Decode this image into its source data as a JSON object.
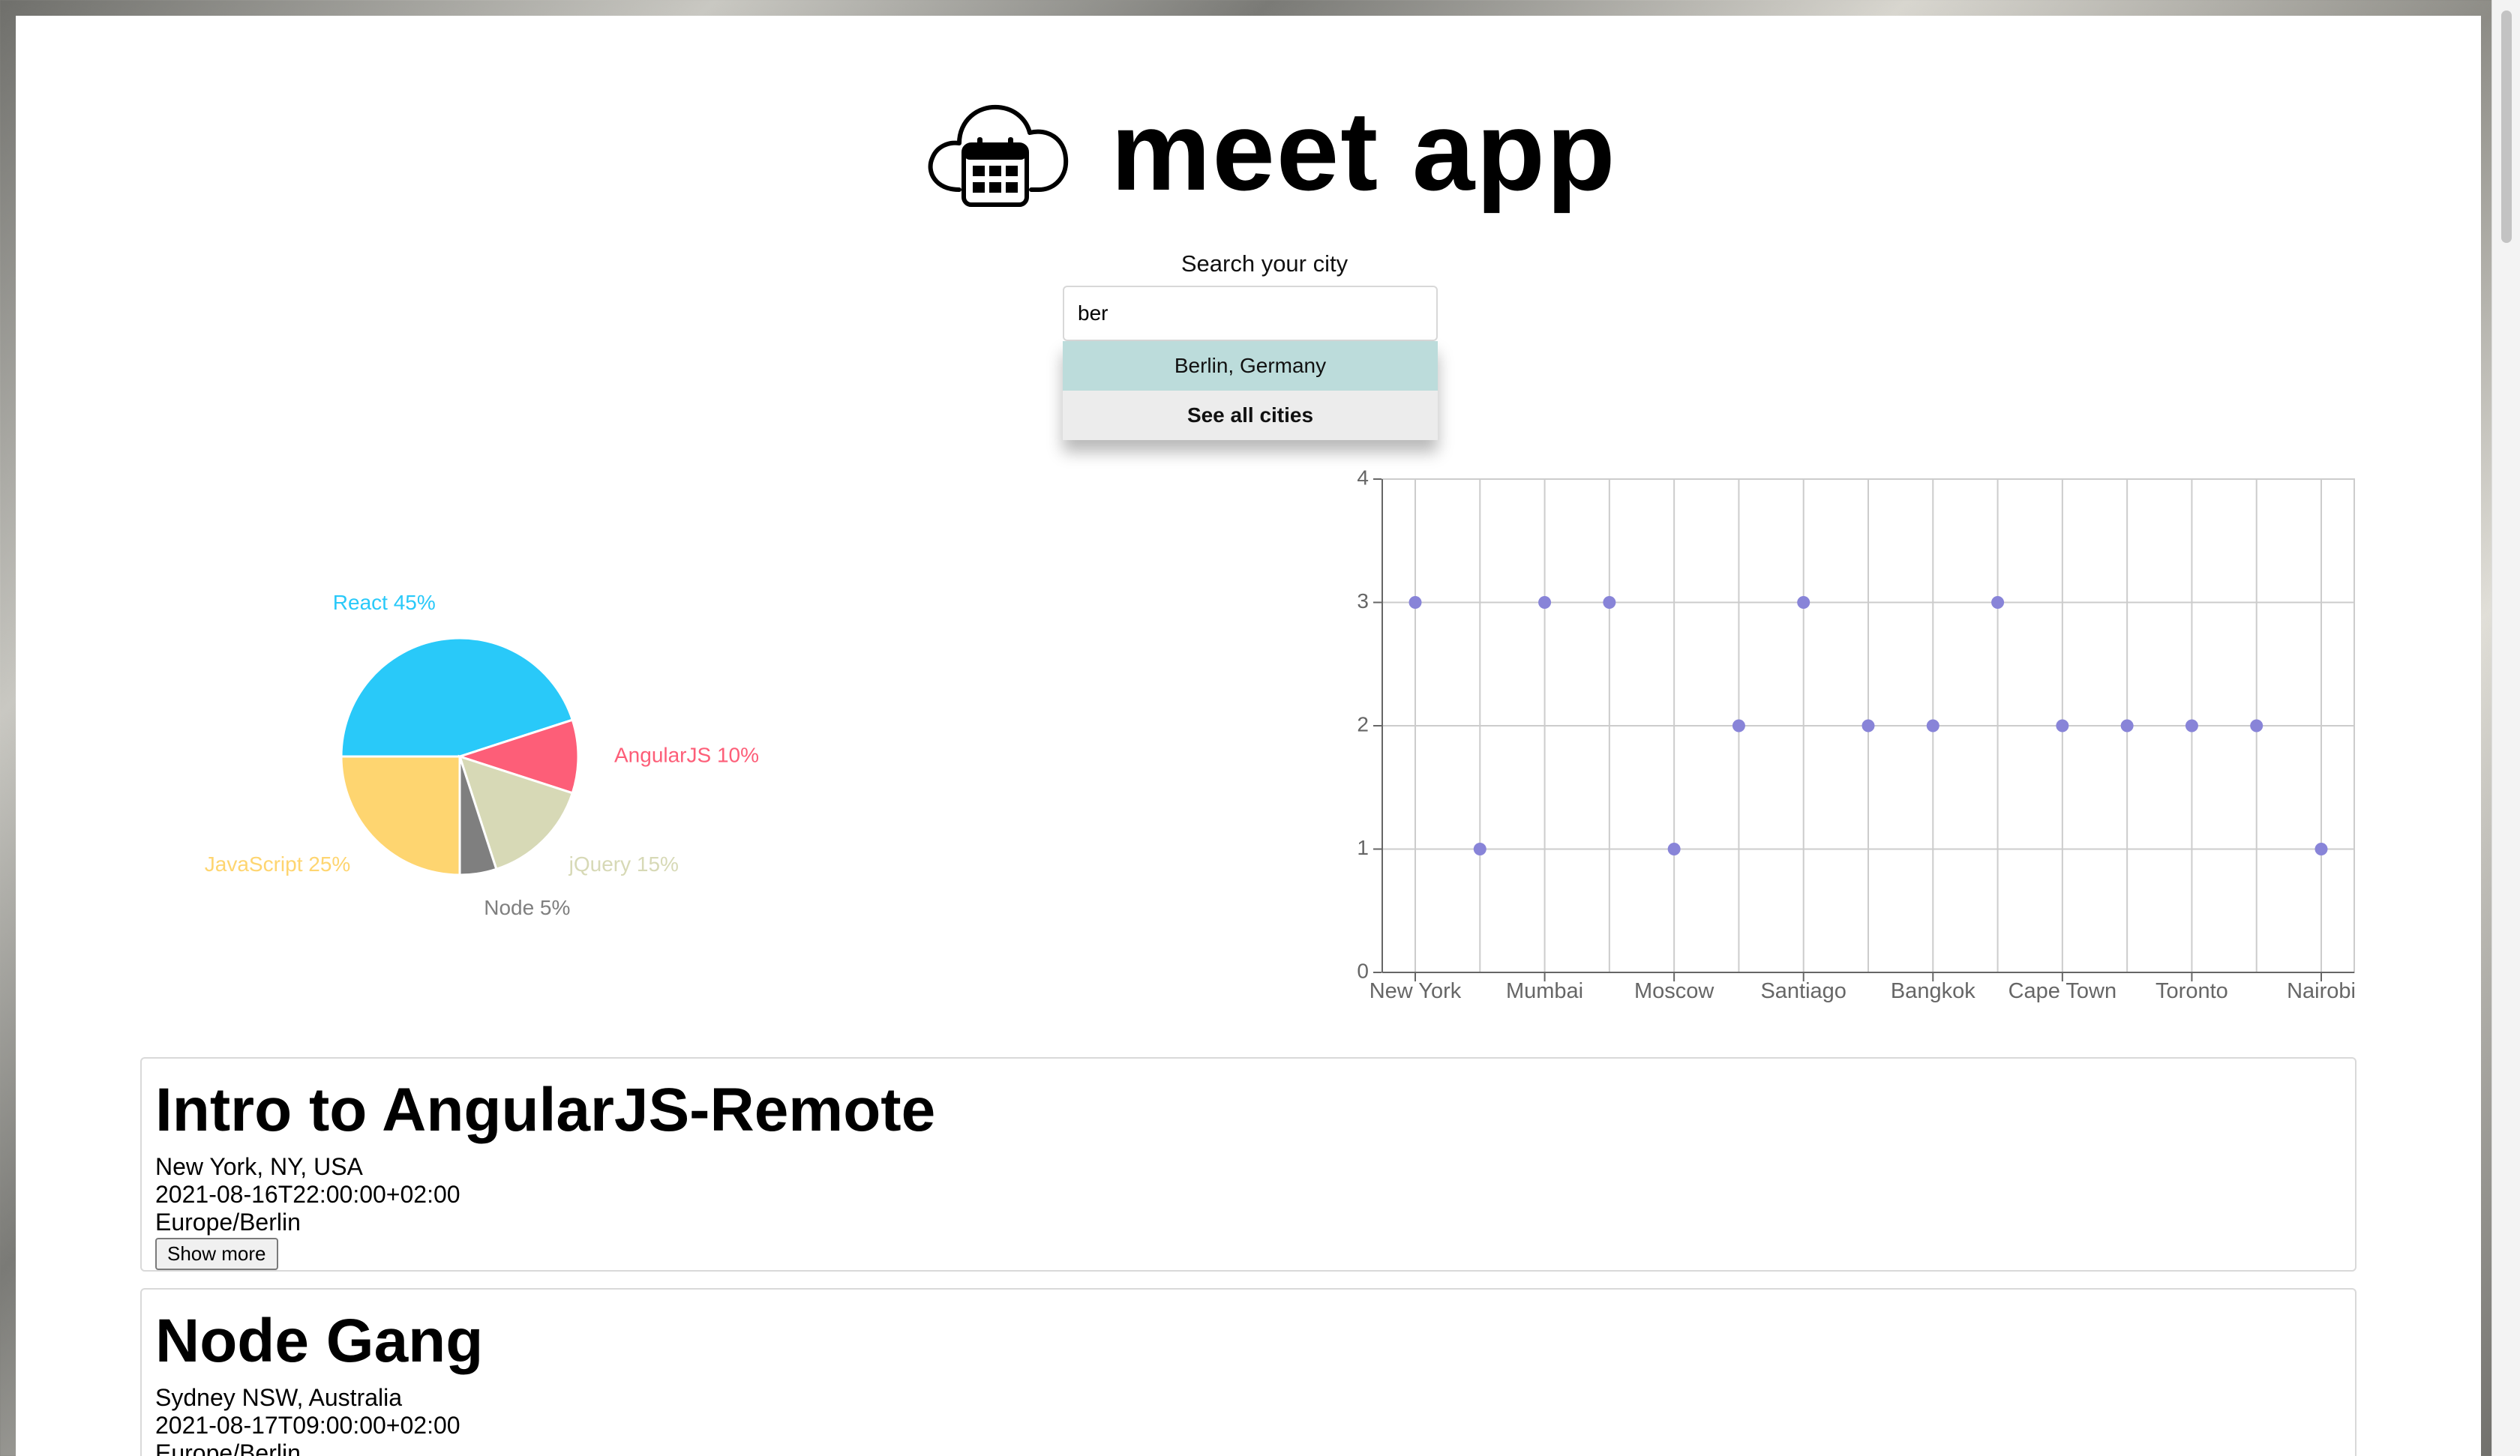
{
  "app": {
    "title": "meet app",
    "logo_icon": "cloud-calendar-icon"
  },
  "search": {
    "label": "Search your city",
    "value": "ber",
    "suggestions": [
      "Berlin, Germany"
    ],
    "see_all_label": "See all cities"
  },
  "colors": {
    "react": "#29c9f9",
    "javascript": "#fed570",
    "angularjs": "#fd5e78",
    "jquery": "#d7d9b6",
    "node": "#7f7f7f",
    "scatter_point": "#8884d8"
  },
  "chart_data": [
    {
      "type": "pie",
      "slices": [
        {
          "name": "React",
          "value": 45,
          "label": "React 45%",
          "color": "#29c9f9"
        },
        {
          "name": "AngularJS",
          "value": 10,
          "label": "AngularJS 10%",
          "color": "#fd5e78"
        },
        {
          "name": "jQuery",
          "value": 15,
          "label": "jQuery 15%",
          "color": "#d7d9b6"
        },
        {
          "name": "Node",
          "value": 5,
          "label": "Node 5%",
          "color": "#7f7f7f"
        },
        {
          "name": "JavaScript",
          "value": 25,
          "label": "JavaScript 25%",
          "color": "#fed570"
        }
      ]
    },
    {
      "type": "scatter",
      "x": [
        "New York",
        "",
        "Mumbai",
        "",
        "Moscow",
        "",
        "Santiago",
        "",
        "Bangkok",
        "",
        "Cape Town",
        "",
        "Toronto",
        "",
        "Nairobi"
      ],
      "xticks": [
        "New York",
        "Mumbai",
        "Moscow",
        "Santiago",
        "Bangkok",
        "Cape Town",
        "Toronto",
        "Nairobi"
      ],
      "y": [
        3,
        1,
        3,
        3,
        1,
        2,
        3,
        2,
        2,
        3,
        2,
        2,
        2,
        2,
        1
      ],
      "yticks": [
        "0",
        "1",
        "2",
        "3",
        "4"
      ],
      "ylim": [
        0,
        4
      ],
      "grid": true
    }
  ],
  "events": [
    {
      "title": "Intro to AngularJS-Remote",
      "location": "New York, NY, USA",
      "start": "2021-08-16T22:00:00+02:00",
      "timezone": "Europe/Berlin",
      "button_label": "Show more"
    },
    {
      "title": "Node Gang",
      "location": "Sydney NSW, Australia",
      "start": "2021-08-17T09:00:00+02:00",
      "timezone": "Europe/Berlin"
    }
  ]
}
